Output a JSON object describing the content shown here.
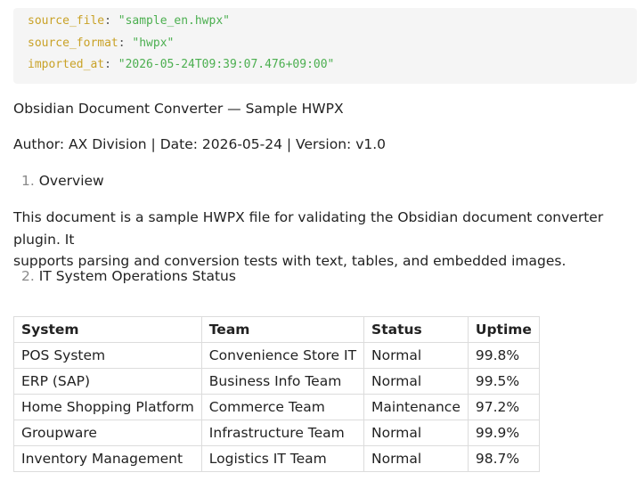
{
  "frontmatter": [
    {
      "key": "source_file",
      "value": "\"sample_en.hwpx\""
    },
    {
      "key": "source_format",
      "value": "\"hwpx\""
    },
    {
      "key": "imported_at",
      "value": "\"2026-05-24T09:39:07.476+09:00\""
    }
  ],
  "doc": {
    "title": "Obsidian Document Converter — Sample HWPX",
    "meta": "Author: AX Division | Date: 2026-05-24 | Version: v1.0",
    "sections": [
      {
        "num": "1.",
        "title": "Overview"
      },
      {
        "num": "2.",
        "title": "IT System Operations Status"
      }
    ],
    "overview_text_line1": "This document is a sample HWPX file for validating the Obsidian document converter plugin. It",
    "overview_text_line2": "supports parsing and conversion tests with text, tables, and embedded images."
  },
  "table": {
    "headers": [
      "System",
      "Team",
      "Status",
      "Uptime"
    ],
    "rows": [
      [
        "POS System",
        "Convenience Store IT",
        "Normal",
        "99.8%"
      ],
      [
        "ERP (SAP)",
        "Business Info Team",
        "Normal",
        "99.5%"
      ],
      [
        "Home Shopping Platform",
        "Commerce Team",
        "Maintenance",
        "97.2%"
      ],
      [
        "Groupware",
        "Infrastructure Team",
        "Normal",
        "99.9%"
      ],
      [
        "Inventory Management",
        "Logistics IT Team",
        "Normal",
        "98.7%"
      ]
    ]
  }
}
